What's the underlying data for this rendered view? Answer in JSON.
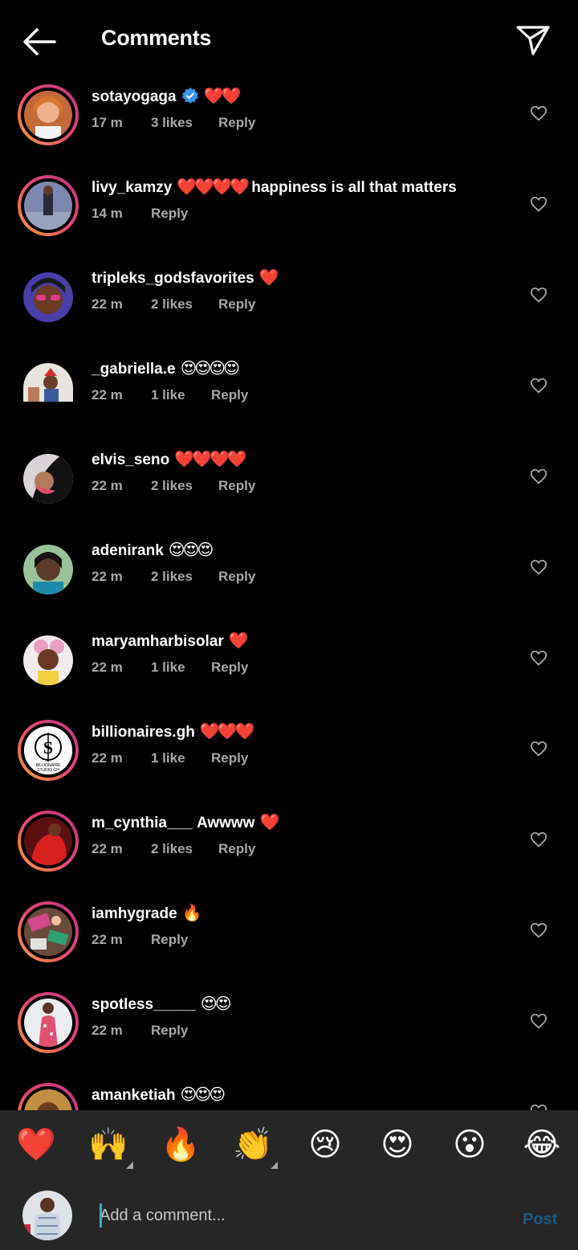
{
  "header": {
    "title": "Comments",
    "back_icon": "arrow-left-icon",
    "send_icon": "paper-plane-icon"
  },
  "comments": [
    {
      "username": "sotayogaga",
      "verified": true,
      "text": "",
      "emoji": "❤️❤️",
      "time": "17 m",
      "likes": "3 likes",
      "reply": "Reply"
    },
    {
      "username": "livy_kamzy",
      "verified": false,
      "text": "",
      "emoji": "❤️❤️❤️❤️",
      "text_after": "happiness is all that matters",
      "time": "14 m",
      "likes": "",
      "reply": "Reply"
    },
    {
      "username": "tripleks_godsfavorites",
      "verified": false,
      "text": "",
      "emoji": "❤️",
      "time": "22 m",
      "likes": "2 likes",
      "reply": "Reply"
    },
    {
      "username": "_gabriella.e",
      "verified": false,
      "text": "",
      "emoji": "😍😍😍😍",
      "time": "22 m",
      "likes": "1 like",
      "reply": "Reply"
    },
    {
      "username": "elvis_seno",
      "verified": false,
      "text": "",
      "emoji": "❤️❤️❤️❤️",
      "time": "22 m",
      "likes": "2 likes",
      "reply": "Reply"
    },
    {
      "username": "adenirank",
      "verified": false,
      "text": "",
      "emoji": "😍😍😍",
      "time": "22 m",
      "likes": "2 likes",
      "reply": "Reply"
    },
    {
      "username": "maryamharbisolar",
      "verified": false,
      "text": "",
      "emoji": "❤️",
      "time": "22 m",
      "likes": "1 like",
      "reply": "Reply"
    },
    {
      "username": "billionaires.gh",
      "verified": false,
      "text": "",
      "emoji": "❤️❤️❤️",
      "time": "22 m",
      "likes": "1 like",
      "reply": "Reply",
      "avatar_text": "BILLIONAIRE STUDIO GH"
    },
    {
      "username": "m_cynthia___",
      "verified": false,
      "text": "Awwww",
      "emoji": "❤️",
      "time": "22 m",
      "likes": "2 likes",
      "reply": "Reply"
    },
    {
      "username": "iamhygrade",
      "verified": false,
      "text": "",
      "emoji": "🔥",
      "time": "22 m",
      "likes": "",
      "reply": "Reply"
    },
    {
      "username": "spotless_____",
      "verified": false,
      "text": "",
      "emoji": "😍😍",
      "time": "22 m",
      "likes": "",
      "reply": "Reply"
    },
    {
      "username": "amanketiah",
      "verified": false,
      "text": "",
      "emoji": "😍😍😍",
      "time": "",
      "likes": "",
      "reply": ""
    }
  ],
  "emoji_bar": [
    "❤️",
    "🙌",
    "🔥",
    "👏",
    "😢",
    "😍",
    "😮",
    "😂"
  ],
  "composer": {
    "placeholder": "Add a comment...",
    "post_label": "Post"
  },
  "colors": {
    "background": "#000000",
    "muted": "#a8a8a8",
    "bar": "#262626",
    "post": "#1c5a87",
    "verified": "#3897f0",
    "ring_start": "#f9a33c",
    "ring_end": "#c13584"
  }
}
